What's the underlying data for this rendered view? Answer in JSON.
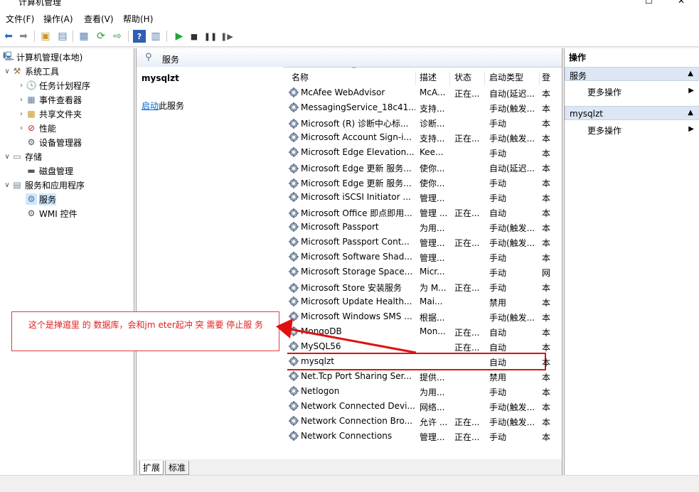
{
  "window": {
    "title": "计算机管理"
  },
  "menu": [
    "文件(F)",
    "操作(A)",
    "查看(V)",
    "帮助(H)"
  ],
  "tree": {
    "root": "计算机管理(本地)",
    "system_tools": "系统工具",
    "task_scheduler": "任务计划程序",
    "event_viewer": "事件查看器",
    "shared_folders": "共享文件夹",
    "performance": "性能",
    "device_manager": "设备管理器",
    "storage": "存储",
    "disk_management": "磁盘管理",
    "services_apps": "服务和应用程序",
    "services": "服务",
    "wmi": "WMI 控件"
  },
  "middle": {
    "header": "服务",
    "selected_service": "mysqlzt",
    "start_link": "启动",
    "start_suffix": "此服务",
    "columns": [
      "名称",
      "描述",
      "状态",
      "启动类型",
      "登"
    ],
    "rows": [
      {
        "name": "McAfee WebAdvisor",
        "desc": "McA...",
        "status": "正在...",
        "startup": "自动(延迟...",
        "logon": "本"
      },
      {
        "name": "MessagingService_18c41...",
        "desc": "支持...",
        "status": "",
        "startup": "手动(触发...",
        "logon": "本"
      },
      {
        "name": "Microsoft (R) 诊断中心标...",
        "desc": "诊断...",
        "status": "",
        "startup": "手动",
        "logon": "本"
      },
      {
        "name": "Microsoft Account Sign-i...",
        "desc": "支持...",
        "status": "正在...",
        "startup": "手动(触发...",
        "logon": "本"
      },
      {
        "name": "Microsoft Edge Elevation...",
        "desc": "Kee...",
        "status": "",
        "startup": "手动",
        "logon": "本"
      },
      {
        "name": "Microsoft Edge 更新 服务...",
        "desc": "使你...",
        "status": "",
        "startup": "自动(延迟...",
        "logon": "本"
      },
      {
        "name": "Microsoft Edge 更新 服务...",
        "desc": "使你...",
        "status": "",
        "startup": "手动",
        "logon": "本"
      },
      {
        "name": "Microsoft iSCSI Initiator ...",
        "desc": "管理...",
        "status": "",
        "startup": "手动",
        "logon": "本"
      },
      {
        "name": "Microsoft Office 即点即用...",
        "desc": "管理 ...",
        "status": "正在...",
        "startup": "自动",
        "logon": "本"
      },
      {
        "name": "Microsoft Passport",
        "desc": "为用...",
        "status": "",
        "startup": "手动(触发...",
        "logon": "本"
      },
      {
        "name": "Microsoft Passport Cont...",
        "desc": "管理...",
        "status": "正在...",
        "startup": "手动(触发...",
        "logon": "本"
      },
      {
        "name": "Microsoft Software Shad...",
        "desc": "管理...",
        "status": "",
        "startup": "手动",
        "logon": "本"
      },
      {
        "name": "Microsoft Storage Space...",
        "desc": "Micr...",
        "status": "",
        "startup": "手动",
        "logon": "网"
      },
      {
        "name": "Microsoft Store 安装服务",
        "desc": "为 M...",
        "status": "正在...",
        "startup": "手动",
        "logon": "本"
      },
      {
        "name": "Microsoft Update Health...",
        "desc": "Mai...",
        "status": "",
        "startup": "禁用",
        "logon": "本"
      },
      {
        "name": "Microsoft Windows SMS ...",
        "desc": "根据...",
        "status": "",
        "startup": "手动(触发...",
        "logon": "本"
      },
      {
        "name": "MongoDB",
        "desc": "Mon...",
        "status": "正在...",
        "startup": "自动",
        "logon": "本"
      },
      {
        "name": "MySQL56",
        "desc": "",
        "status": "正在...",
        "startup": "自动",
        "logon": "本"
      },
      {
        "name": "mysqlzt",
        "desc": "",
        "status": "",
        "startup": "自动",
        "logon": "本"
      },
      {
        "name": "Net.Tcp Port Sharing Ser...",
        "desc": "提供...",
        "status": "",
        "startup": "禁用",
        "logon": "本"
      },
      {
        "name": "Netlogon",
        "desc": "为用...",
        "status": "",
        "startup": "手动",
        "logon": "本"
      },
      {
        "name": "Network Connected Devi...",
        "desc": "网络...",
        "status": "",
        "startup": "手动(触发...",
        "logon": "本"
      },
      {
        "name": "Network Connection Bro...",
        "desc": "允许 ...",
        "status": "正在...",
        "startup": "手动(触发...",
        "logon": "本"
      },
      {
        "name": "Network Connections",
        "desc": "管理...",
        "status": "正在...",
        "startup": "手动",
        "logon": "本"
      }
    ],
    "tabs": [
      "扩展",
      "标准"
    ]
  },
  "actions": {
    "title": "操作",
    "section1": "服务",
    "section1_item": "更多操作",
    "section2": "mysqlzt",
    "section2_item": "更多操作"
  },
  "annotation": {
    "text": "这个是掸逭里 的 数据库，会和jm eter起冲 突  需要 停止服 务"
  },
  "colors": {
    "highlight_border": "#e01010",
    "annotation_text": "#e02020",
    "link": "#0066cc"
  }
}
